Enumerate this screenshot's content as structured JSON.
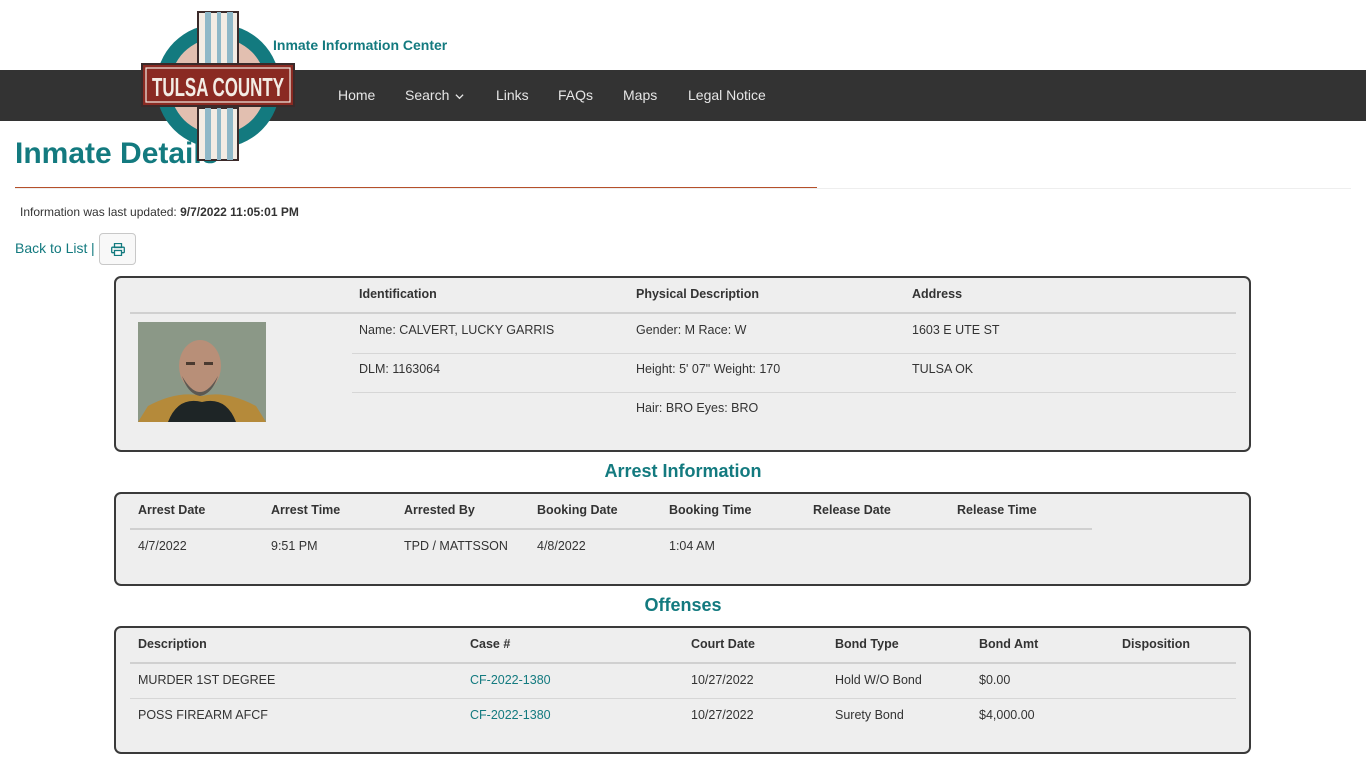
{
  "header": {
    "site_title": "Inmate Information Center",
    "logo_text": "TULSA COUNTY",
    "nav": [
      {
        "label": "Home"
      },
      {
        "label": "Search"
      },
      {
        "label": "Links"
      },
      {
        "label": "FAQs"
      },
      {
        "label": "Maps"
      },
      {
        "label": "Legal Notice"
      }
    ]
  },
  "page": {
    "title": "Inmate Details",
    "updated_label": "Information was last updated:",
    "updated_value": "9/7/2022 11:05:01 PM",
    "back_label": "Back to List",
    "separator": "|"
  },
  "identity": {
    "headers": {
      "identification": "Identification",
      "physical": "Physical Description",
      "address": "Address"
    },
    "name": "Name: CALVERT, LUCKY GARRIS",
    "dlm": "DLM: 1163064",
    "gender_race": "Gender: M Race: W",
    "height_weight": "Height: 5' 07\" Weight: 170",
    "hair_eyes": "Hair: BRO Eyes: BRO",
    "address_line1": "1603 E UTE ST",
    "address_line2": "TULSA OK"
  },
  "arrest": {
    "title": "Arrest Information",
    "headers": [
      "Arrest Date",
      "Arrest Time",
      "Arrested By",
      "Booking Date",
      "Booking Time",
      "Release Date",
      "Release Time"
    ],
    "row": [
      "4/7/2022",
      "9:51 PM",
      "TPD / MATTSSON",
      "4/8/2022",
      "1:04 AM",
      "",
      ""
    ]
  },
  "offenses": {
    "title": "Offenses",
    "headers": [
      "Description",
      "Case #",
      "Court Date",
      "Bond Type",
      "Bond Amt",
      "Disposition"
    ],
    "rows": [
      [
        "MURDER 1ST DEGREE",
        "CF-2022-1380",
        "10/27/2022",
        "Hold W/O Bond",
        "$0.00",
        ""
      ],
      [
        "POSS FIREARM AFCF",
        "CF-2022-1380",
        "10/27/2022",
        "Surety Bond",
        "$4,000.00",
        ""
      ]
    ]
  },
  "colors": {
    "accent": "#137a7f",
    "navbar": "#333333",
    "rule_accent": "#b5502a",
    "panel_bg": "#eeeeee"
  },
  "icons": [
    "chevron-down-icon",
    "print-icon",
    "tulsa-county-logo"
  ]
}
